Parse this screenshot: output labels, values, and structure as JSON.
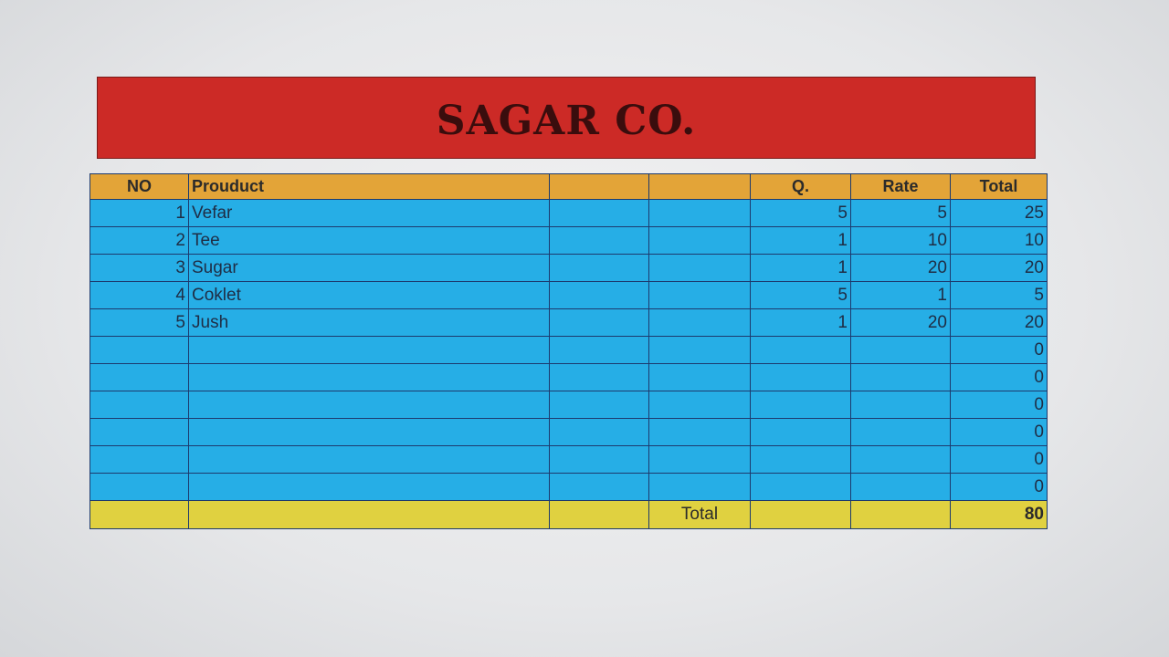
{
  "sheet": {
    "company_name": "SAGAR CO.",
    "headers": {
      "no": "NO",
      "product": "Prouduct",
      "blank1": "",
      "blank2": "",
      "qty": "Q.",
      "rate": "Rate",
      "total": "Total"
    },
    "rows": [
      {
        "no": "1",
        "product": "Vefar",
        "c3": "",
        "c4": "",
        "qty": "5",
        "rate": "5",
        "total": "25"
      },
      {
        "no": "2",
        "product": "Tee",
        "c3": "",
        "c4": "",
        "qty": "1",
        "rate": "10",
        "total": "10"
      },
      {
        "no": "3",
        "product": "Sugar",
        "c3": "",
        "c4": "",
        "qty": "1",
        "rate": "20",
        "total": "20"
      },
      {
        "no": "4",
        "product": "Coklet",
        "c3": "",
        "c4": "",
        "qty": "5",
        "rate": "1",
        "total": "5"
      },
      {
        "no": "5",
        "product": "Jush",
        "c3": "",
        "c4": "",
        "qty": "1",
        "rate": "20",
        "total": "20"
      },
      {
        "no": "",
        "product": "",
        "c3": "",
        "c4": "",
        "qty": "",
        "rate": "",
        "total": "0"
      },
      {
        "no": "",
        "product": "",
        "c3": "",
        "c4": "",
        "qty": "",
        "rate": "",
        "total": "0"
      },
      {
        "no": "",
        "product": "",
        "c3": "",
        "c4": "",
        "qty": "",
        "rate": "",
        "total": "0"
      },
      {
        "no": "",
        "product": "",
        "c3": "",
        "c4": "",
        "qty": "",
        "rate": "",
        "total": "0"
      },
      {
        "no": "",
        "product": "",
        "c3": "",
        "c4": "",
        "qty": "",
        "rate": "",
        "total": "0"
      },
      {
        "no": "",
        "product": "",
        "c3": "",
        "c4": "",
        "qty": "",
        "rate": "",
        "total": "0"
      }
    ],
    "footer": {
      "label": "Total",
      "grand_total": "80"
    },
    "colors": {
      "banner": "#cc2a26",
      "header": "#e3a438",
      "body": "#26aee6",
      "footer": "#e0d140"
    }
  }
}
